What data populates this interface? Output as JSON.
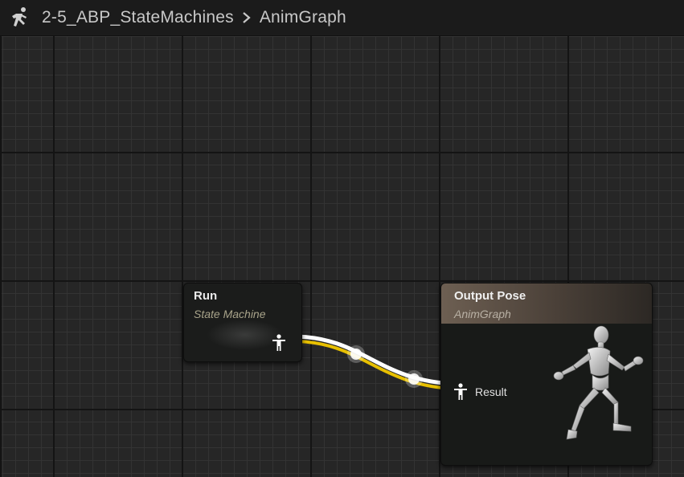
{
  "breadcrumb": {
    "icon": "running-figure-icon",
    "asset": "2-5_ABP_StateMachines",
    "separator_icon": "chevron-right-icon",
    "graph": "AnimGraph"
  },
  "nodes": {
    "run": {
      "title": "Run",
      "subtitle": "State Machine",
      "output_pin_icon": "pose-pin-icon"
    },
    "output_pose": {
      "title": "Output Pose",
      "subtitle": "AnimGraph",
      "input_pin_icon": "pose-pin-icon",
      "input_pin_label": "Result",
      "preview": "mannequin-running-icon"
    }
  },
  "colors": {
    "wire_white": "#ffffff",
    "wire_yellow": "#f0c800",
    "header_brown": "#6d5f52",
    "background": "#262626"
  }
}
